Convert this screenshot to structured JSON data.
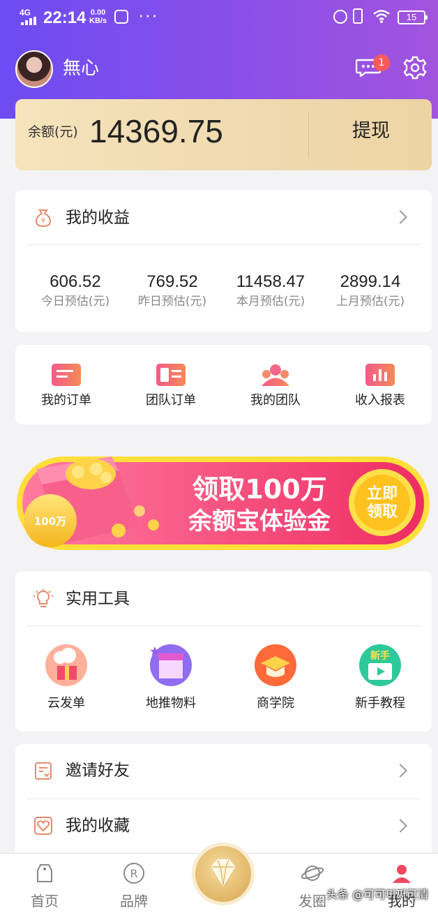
{
  "status_bar": {
    "network": "4G",
    "time": "22:14",
    "speed_value": "0.00",
    "speed_unit": "KB/s",
    "more": "···",
    "battery": "15"
  },
  "header": {
    "username": "無心",
    "message_badge": "1",
    "icons": [
      "avatar",
      "message-icon",
      "gear-icon"
    ]
  },
  "balance": {
    "label": "余额(元)",
    "amount": "14369.75",
    "withdraw_label": "提现"
  },
  "earnings": {
    "title": "我的收益",
    "items": [
      {
        "value": "606.52",
        "label": "今日预估(元)"
      },
      {
        "value": "769.52",
        "label": "昨日预估(元)"
      },
      {
        "value": "11458.47",
        "label": "本月预估(元)"
      },
      {
        "value": "2899.14",
        "label": "上月预估(元)"
      }
    ]
  },
  "orders": {
    "items": [
      {
        "label": "我的订单",
        "icon": "order-icon"
      },
      {
        "label": "团队订单",
        "icon": "team-order-icon"
      },
      {
        "label": "我的团队",
        "icon": "team-icon"
      },
      {
        "label": "收入报表",
        "icon": "report-icon"
      }
    ]
  },
  "banner": {
    "line1": "领取100万",
    "line2": "余额宝体验金",
    "cta_line1": "立即",
    "cta_line2": "领取",
    "coin_text": "100万"
  },
  "tools": {
    "title": "实用工具",
    "items": [
      {
        "label": "云发单",
        "icon": "cloud-gift-icon"
      },
      {
        "label": "地推物料",
        "icon": "store-icon"
      },
      {
        "label": "商学院",
        "icon": "graduation-cap-icon"
      },
      {
        "label": "新手教程",
        "icon": "tutorial-icon",
        "icon_text": "新手"
      }
    ]
  },
  "links": {
    "invite": "邀请好友",
    "favorites": "我的收藏"
  },
  "tabbar": {
    "items": [
      {
        "label": "首页",
        "icon": "home-icon"
      },
      {
        "label": "品牌",
        "icon": "brand-icon"
      },
      {
        "label": "发圈",
        "icon": "planet-icon"
      },
      {
        "label": "我的",
        "icon": "profile-icon"
      }
    ],
    "active": "我的",
    "center_icon": "diamond-icon"
  },
  "watermark": "头条 @可可미쩌可清",
  "colors": {
    "header_start": "#6d4cf2",
    "header_end": "#a254de",
    "balance_card": "#f3deb4",
    "accent_red": "#ff5a5a",
    "banner_pink": "#f2486d",
    "banner_yellow": "#ffd84a"
  }
}
